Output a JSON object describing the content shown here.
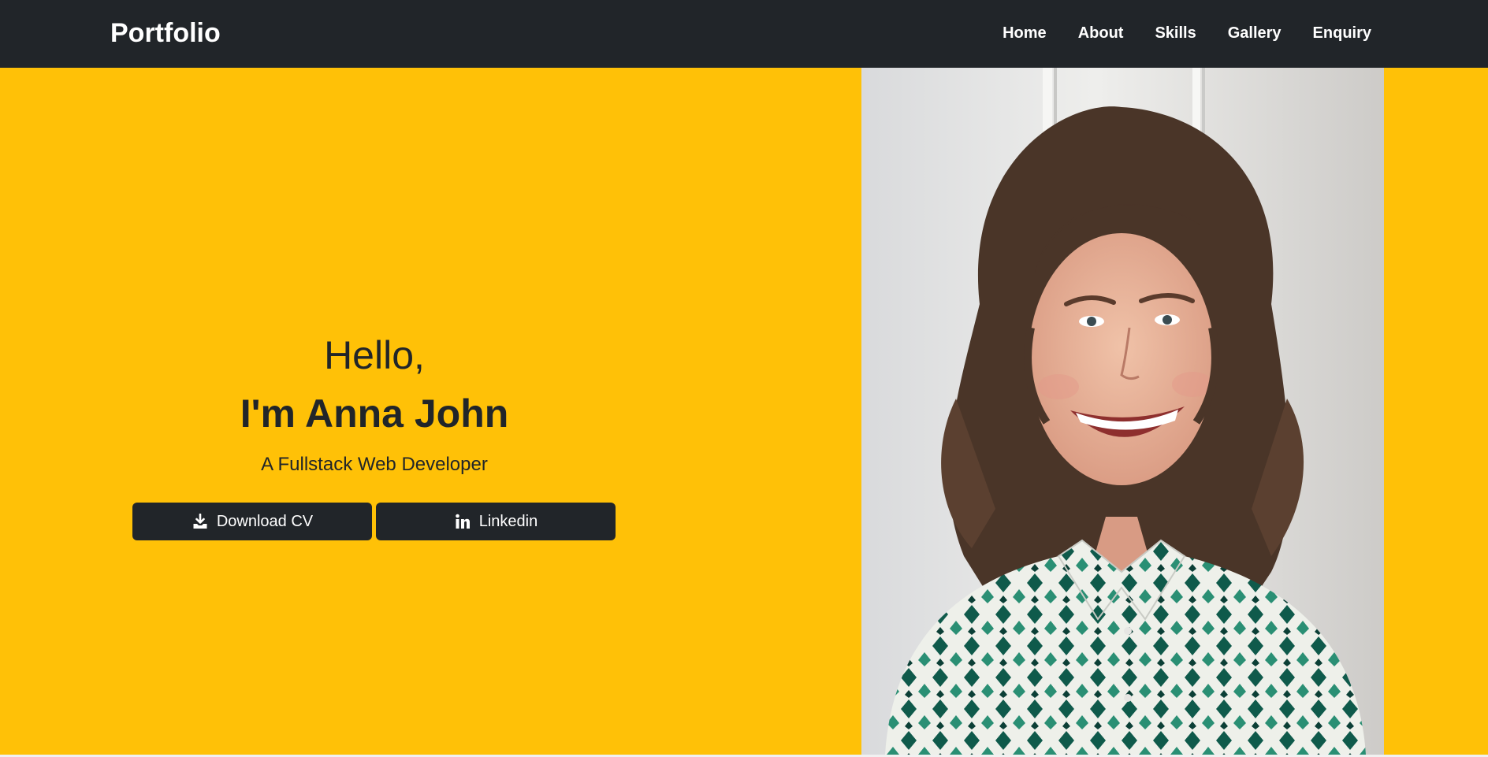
{
  "navbar": {
    "brand": "Portfolio",
    "links": [
      "Home",
      "About",
      "Skills",
      "Gallery",
      "Enquiry"
    ]
  },
  "hero": {
    "greeting": "Hello,",
    "intro_prefix": "I'm ",
    "name": "Anna John",
    "tagline": "A Fullstack Web Developer",
    "buttons": {
      "cv_label": "Download CV",
      "cv_icon": "download-icon",
      "linkedin_label": "Linkedin",
      "linkedin_icon": "linkedin-icon"
    },
    "photo": "portrait of a smiling woman"
  },
  "colors": {
    "navbar": "#212529",
    "hero_background": "#ffc107",
    "button": "#212529",
    "text_dark": "#212529",
    "text_light": "#ffffff"
  }
}
